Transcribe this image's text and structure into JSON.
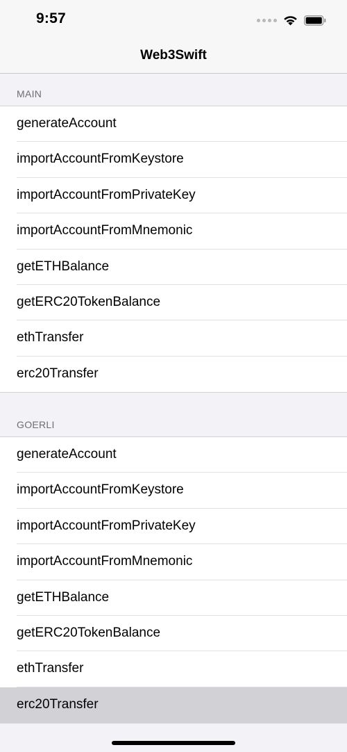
{
  "status": {
    "time": "9:57"
  },
  "nav": {
    "title": "Web3Swift"
  },
  "sections": [
    {
      "header": "MAIN",
      "items": [
        "generateAccount",
        "importAccountFromKeystore",
        "importAccountFromPrivateKey",
        "importAccountFromMnemonic",
        "getETHBalance",
        "getERC20TokenBalance",
        "ethTransfer",
        "erc20Transfer"
      ]
    },
    {
      "header": "GOERLI",
      "items": [
        "generateAccount",
        "importAccountFromKeystore",
        "importAccountFromPrivateKey",
        "importAccountFromMnemonic",
        "getETHBalance",
        "getERC20TokenBalance",
        "ethTransfer",
        "erc20Transfer"
      ]
    }
  ],
  "selected_row": "goerli-erc20Transfer"
}
